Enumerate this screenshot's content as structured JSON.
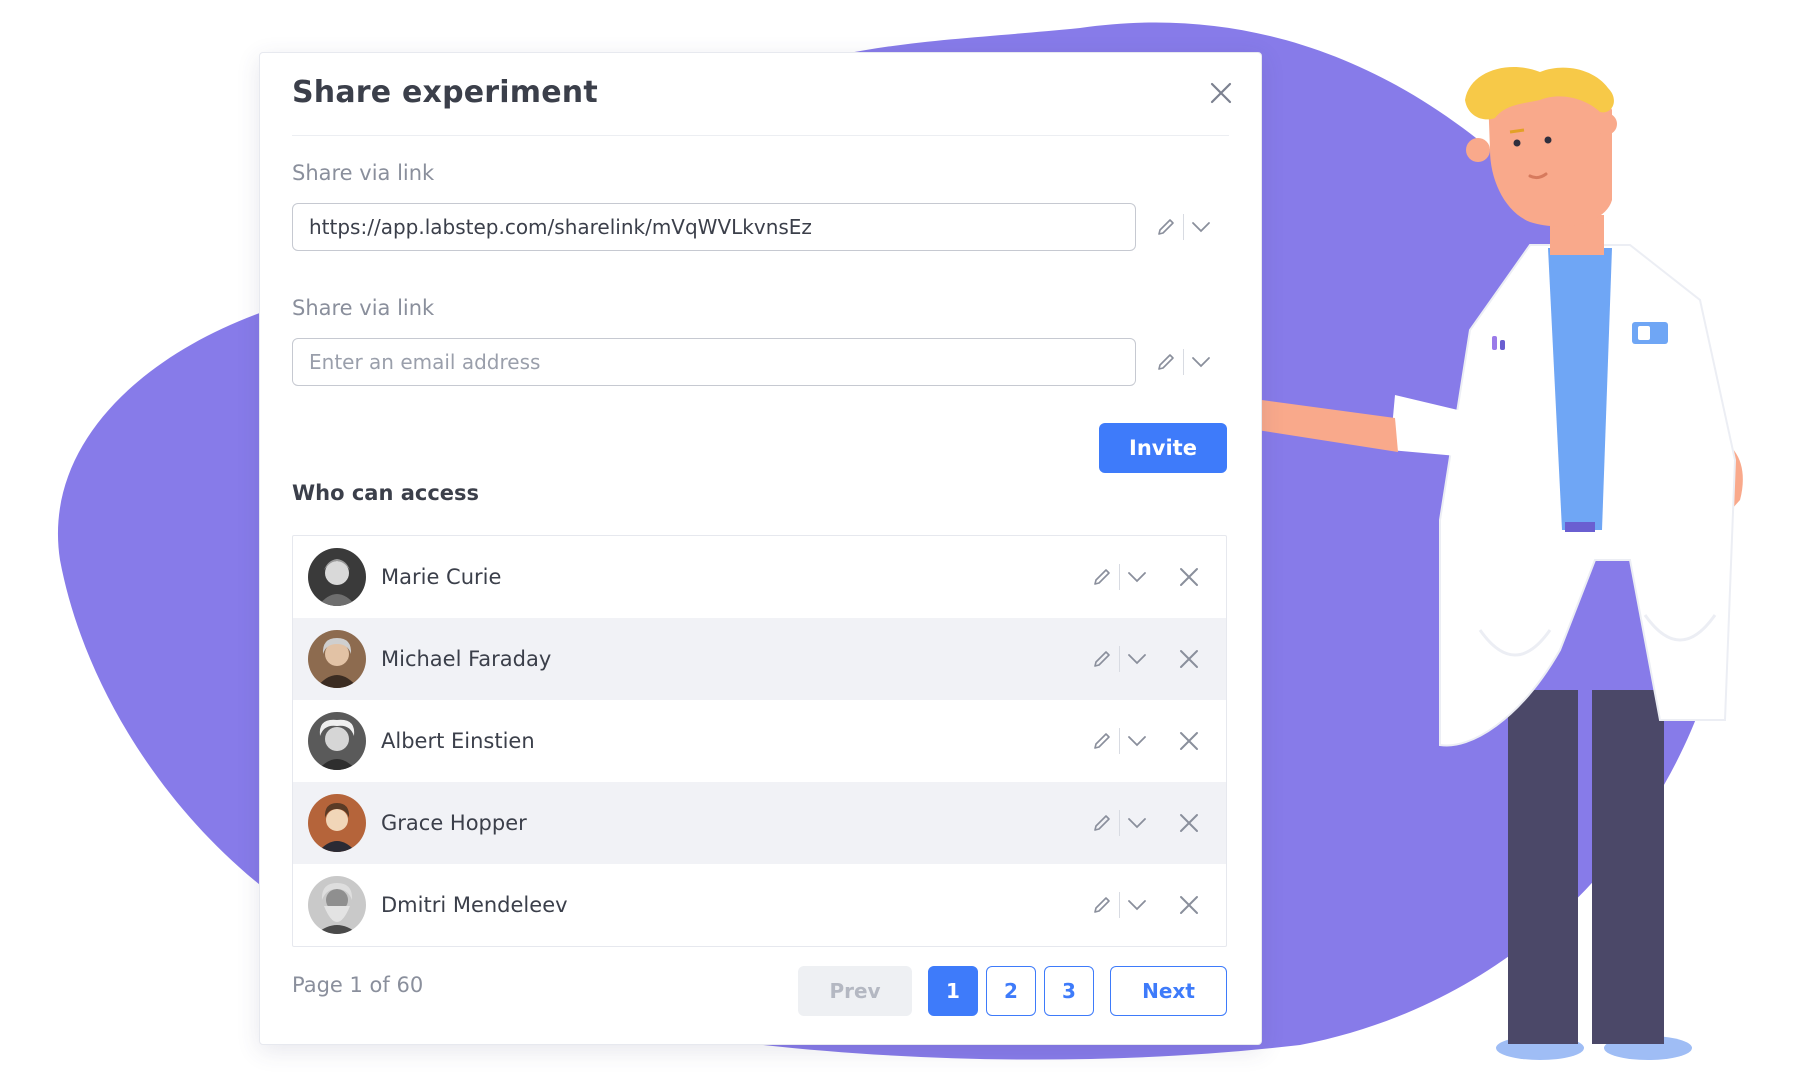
{
  "modal": {
    "title": "Share experiment"
  },
  "share_link": {
    "label": "Share via link",
    "value": "https://app.labstep.com/sharelink/mVqWVLkvnsEz"
  },
  "share_email": {
    "label": "Share via link",
    "placeholder": "Enter an email address"
  },
  "invite_label": "Invite",
  "access": {
    "title": "Who can access",
    "members": [
      {
        "name": "Marie Curie"
      },
      {
        "name": "Michael Faraday"
      },
      {
        "name": "Albert Einstien"
      },
      {
        "name": "Grace Hopper"
      },
      {
        "name": "Dmitri Mendeleev"
      }
    ]
  },
  "pagination": {
    "info": "Page 1 of 60",
    "prev": "Prev",
    "pages": [
      "1",
      "2",
      "3"
    ],
    "current": "1",
    "next": "Next"
  },
  "colors": {
    "accent": "#3e7bfa",
    "blob": "#877be9",
    "text": "#3b3f4a",
    "muted": "#8a8f9c"
  },
  "icons": [
    "close-icon",
    "pencil-icon",
    "chevron-down-icon"
  ]
}
